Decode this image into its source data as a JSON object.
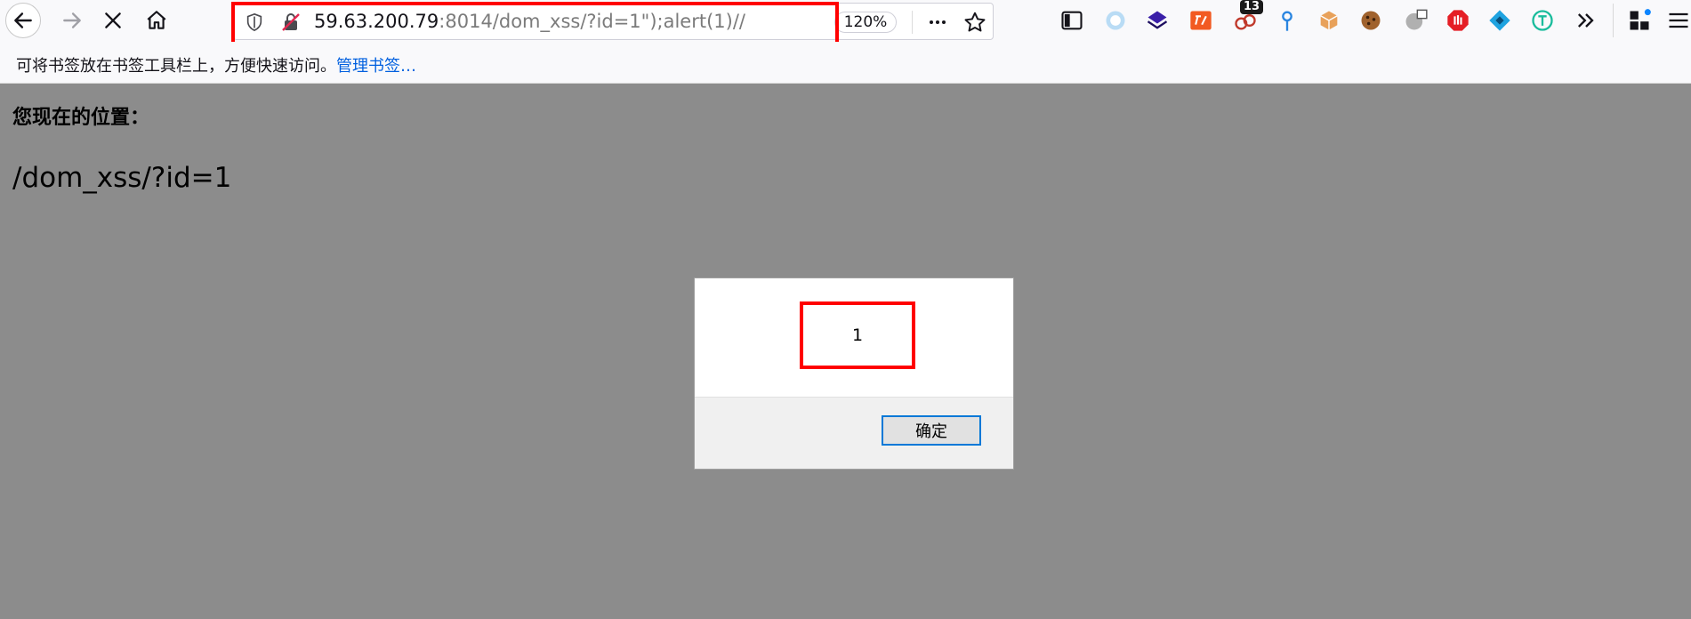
{
  "browser": {
    "url": {
      "host": "59.63.200.79",
      "rest": ":8014/dom_xss/?id=1\");alert(1)//"
    },
    "zoom": "120%",
    "extension_badge": "13",
    "icons": {
      "back": "back-arrow-icon",
      "forward": "forward-arrow-icon",
      "stop": "stop-icon",
      "home": "home-icon",
      "shield": "tracking-shield-icon",
      "insecure": "insecure-connection-icon",
      "more": "page-actions-icon",
      "bookmark": "bookmark-star-icon"
    }
  },
  "bookmarks_bar": {
    "hint": "可将书签放在书签工具栏上，方便快速访问。",
    "manage_link": "管理书签…"
  },
  "page": {
    "location_label": "您现在的位置：",
    "path": "/dom_xss/?id=1"
  },
  "dialog": {
    "message": "1",
    "ok_label": "确定"
  },
  "colors": {
    "highlight": "#ff0000",
    "page_overlay": "#8c8c8c",
    "link": "#0060df",
    "ok_border": "#0078d7"
  }
}
